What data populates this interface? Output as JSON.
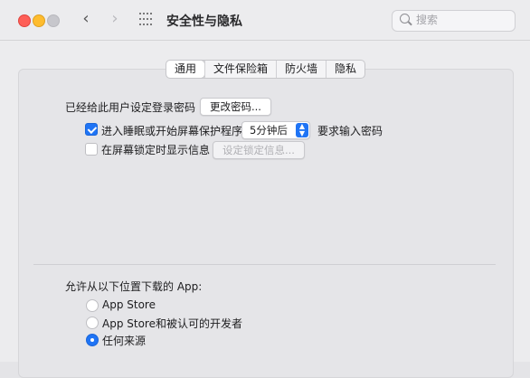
{
  "window": {
    "title": "安全性与隐私",
    "search_placeholder": "搜索",
    "nav": {
      "back": "‹",
      "forward": "›"
    }
  },
  "tabs": [
    {
      "label": "通用",
      "active": true
    },
    {
      "label": "文件保险箱",
      "active": false
    },
    {
      "label": "防火墙",
      "active": false
    },
    {
      "label": "隐私",
      "active": false
    }
  ],
  "general": {
    "password_set_label": "已经给此用户设定登录密码",
    "change_password_button": "更改密码...",
    "require_password": {
      "checked": true,
      "label_before": "进入睡眠或开始屏幕保护程序",
      "select_value": "5分钟后",
      "label_after": "要求输入密码"
    },
    "lock_message": {
      "checked": false,
      "label": "在屏幕锁定时显示信息",
      "button": "设定锁定信息..."
    }
  },
  "downloads": {
    "heading": "允许从以下位置下载的 App:",
    "options": [
      {
        "label": "App Store",
        "selected": false
      },
      {
        "label": "App Store和被认可的开发者",
        "selected": false
      },
      {
        "label": "任何来源",
        "selected": true
      }
    ]
  },
  "colors": {
    "accent": "#1f74f5",
    "close": "#fe5f57",
    "minimize": "#febc2e"
  }
}
